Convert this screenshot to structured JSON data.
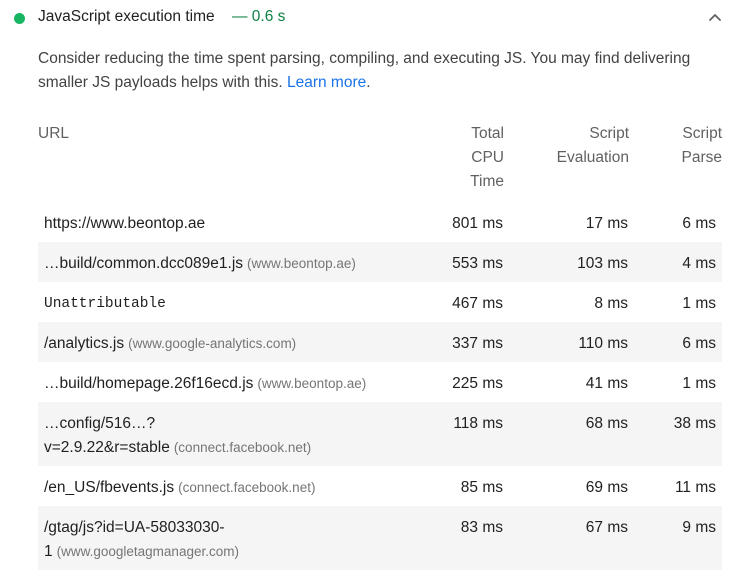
{
  "audit": {
    "title": "JavaScript execution time",
    "value": "— 0.6 s",
    "description": "Consider reducing the time spent parsing, compiling, and executing JS. You may find delivering smaller JS payloads helps with this.",
    "learn_more": "Learn more",
    "after_link": "."
  },
  "colors": {
    "pass": "#18b663",
    "value": "#0b8043",
    "link": "#1a73e8"
  },
  "icons": {
    "status": "pass-circle-icon",
    "toggle": "chevron-up-icon"
  },
  "table": {
    "headers": {
      "url": "URL",
      "cpu": [
        "Total",
        "CPU",
        "Time"
      ],
      "eval": [
        "Script",
        "Evaluation"
      ],
      "parse": [
        "Script",
        "Parse"
      ]
    },
    "rows": [
      {
        "url": "https://www.beontop.ae",
        "host": "",
        "cpu": "801 ms",
        "eval": "17 ms",
        "parse": "6 ms"
      },
      {
        "url": "…build/common.dcc089e1.js",
        "host": "(www.beontop.ae)",
        "cpu": "553 ms",
        "eval": "103 ms",
        "parse": "4 ms"
      },
      {
        "url": "Unattributable",
        "host": "",
        "cpu": "467 ms",
        "eval": "8 ms",
        "parse": "1 ms"
      },
      {
        "url": "/analytics.js",
        "host": "(www.google-analytics.com)",
        "cpu": "337 ms",
        "eval": "110 ms",
        "parse": "6 ms"
      },
      {
        "url": "…build/homepage.26f16ecd.js",
        "host": "(www.beontop.ae)",
        "cpu": "225 ms",
        "eval": "41 ms",
        "parse": "1 ms"
      },
      {
        "url": "…config/516…?",
        "url2": "v=2.9.22&r=stable",
        "host": "(connect.facebook.net)",
        "cpu": "118 ms",
        "eval": "68 ms",
        "parse": "38 ms"
      },
      {
        "url": "/en_US/fbevents.js",
        "host": "(connect.facebook.net)",
        "cpu": "85 ms",
        "eval": "69 ms",
        "parse": "11 ms"
      },
      {
        "url": "/gtag/js?id=UA-58033030-",
        "url2": "1",
        "host": "(www.googletagmanager.com)",
        "cpu": "83 ms",
        "eval": "67 ms",
        "parse": "9 ms"
      }
    ]
  }
}
